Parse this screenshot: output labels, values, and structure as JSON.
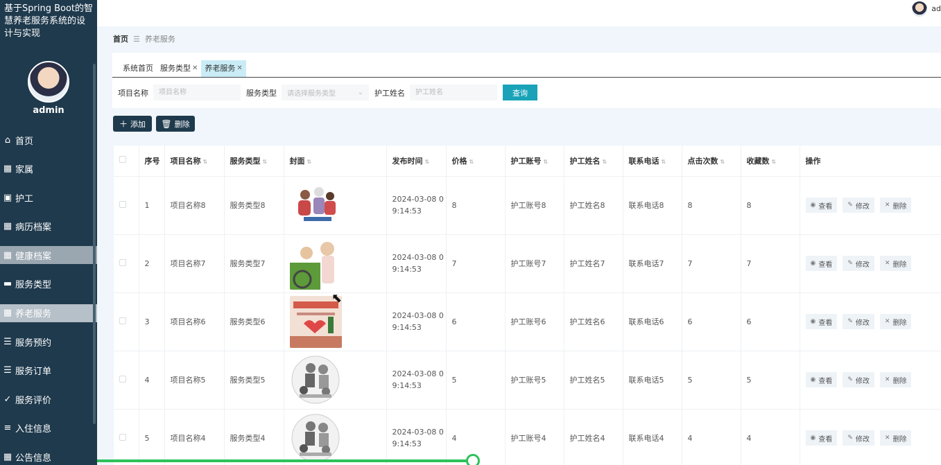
{
  "sidebar": {
    "app_title": "基于Spring Boot的智慧养老服务系统的设计与实现",
    "user_name": "admin",
    "items": [
      {
        "label": "首页",
        "icon": "home-icon"
      },
      {
        "label": "家属",
        "icon": "grid-icon"
      },
      {
        "label": "护工",
        "icon": "briefcase-icon"
      },
      {
        "label": "病历档案",
        "icon": "grid-icon"
      },
      {
        "label": "健康档案",
        "icon": "grid-icon"
      },
      {
        "label": "服务类型",
        "icon": "chat-icon"
      },
      {
        "label": "养老服务",
        "icon": "grid-icon"
      },
      {
        "label": "服务预约",
        "icon": "list-icon"
      },
      {
        "label": "服务订单",
        "icon": "list-icon"
      },
      {
        "label": "服务评价",
        "icon": "clipboard-icon"
      },
      {
        "label": "入住信息",
        "icon": "sliders-icon"
      },
      {
        "label": "公告信息",
        "icon": "grid-icon"
      }
    ]
  },
  "topbar": {
    "user": "ad"
  },
  "breadcrumb": {
    "home": "首页",
    "current": "养老服务"
  },
  "tabs": [
    {
      "label": "系统首页",
      "closable": false
    },
    {
      "label": "服务类型",
      "closable": true
    },
    {
      "label": "养老服务",
      "closable": true
    }
  ],
  "search": {
    "project_label": "项目名称",
    "project_placeholder": "项目名称",
    "type_label": "服务类型",
    "type_placeholder": "请选择服务类型",
    "nurse_label": "护工姓名",
    "nurse_placeholder": "护工姓名",
    "query_button": "查询"
  },
  "actions": {
    "add": "添加",
    "delete": "删除"
  },
  "table": {
    "headers": [
      "序号",
      "项目名称",
      "服务类型",
      "封面",
      "发布时间",
      "价格",
      "护工账号",
      "护工姓名",
      "联系电话",
      "点击次数",
      "收藏数",
      "操作"
    ],
    "op_labels": {
      "view": "查看",
      "edit": "修改",
      "delete": "删除"
    },
    "rows": [
      {
        "no": "1",
        "name": "项目名称8",
        "type": "服务类型8",
        "time_a": "2024-03-08 0",
        "time_b": "9:14:53",
        "price": "8",
        "account": "护工账号8",
        "nurse": "护工姓名8",
        "phone": "联系电话8",
        "clicks": "8",
        "favs": "8"
      },
      {
        "no": "2",
        "name": "项目名称7",
        "type": "服务类型7",
        "time_a": "2024-03-08 0",
        "time_b": "9:14:53",
        "price": "7",
        "account": "护工账号7",
        "nurse": "护工姓名7",
        "phone": "联系电话7",
        "clicks": "7",
        "favs": "7"
      },
      {
        "no": "3",
        "name": "项目名称6",
        "type": "服务类型6",
        "time_a": "2024-03-08 0",
        "time_b": "9:14:53",
        "price": "6",
        "account": "护工账号6",
        "nurse": "护工姓名6",
        "phone": "联系电话6",
        "clicks": "6",
        "favs": "6"
      },
      {
        "no": "4",
        "name": "项目名称5",
        "type": "服务类型5",
        "time_a": "2024-03-08 0",
        "time_b": "9:14:53",
        "price": "5",
        "account": "护工账号5",
        "nurse": "护工姓名5",
        "phone": "联系电话5",
        "clicks": "5",
        "favs": "5"
      },
      {
        "no": "5",
        "name": "项目名称4",
        "type": "服务类型4",
        "time_a": "2024-03-08 0",
        "time_b": "9:14:53",
        "price": "4",
        "account": "护工账号4",
        "nurse": "护工姓名4",
        "phone": "联系电话4",
        "clicks": "4",
        "favs": "4"
      }
    ]
  },
  "colors": {
    "sidebar_bg": "#1f3a4d",
    "accent": "#1aa3b8",
    "progress": "#2ec25a"
  }
}
